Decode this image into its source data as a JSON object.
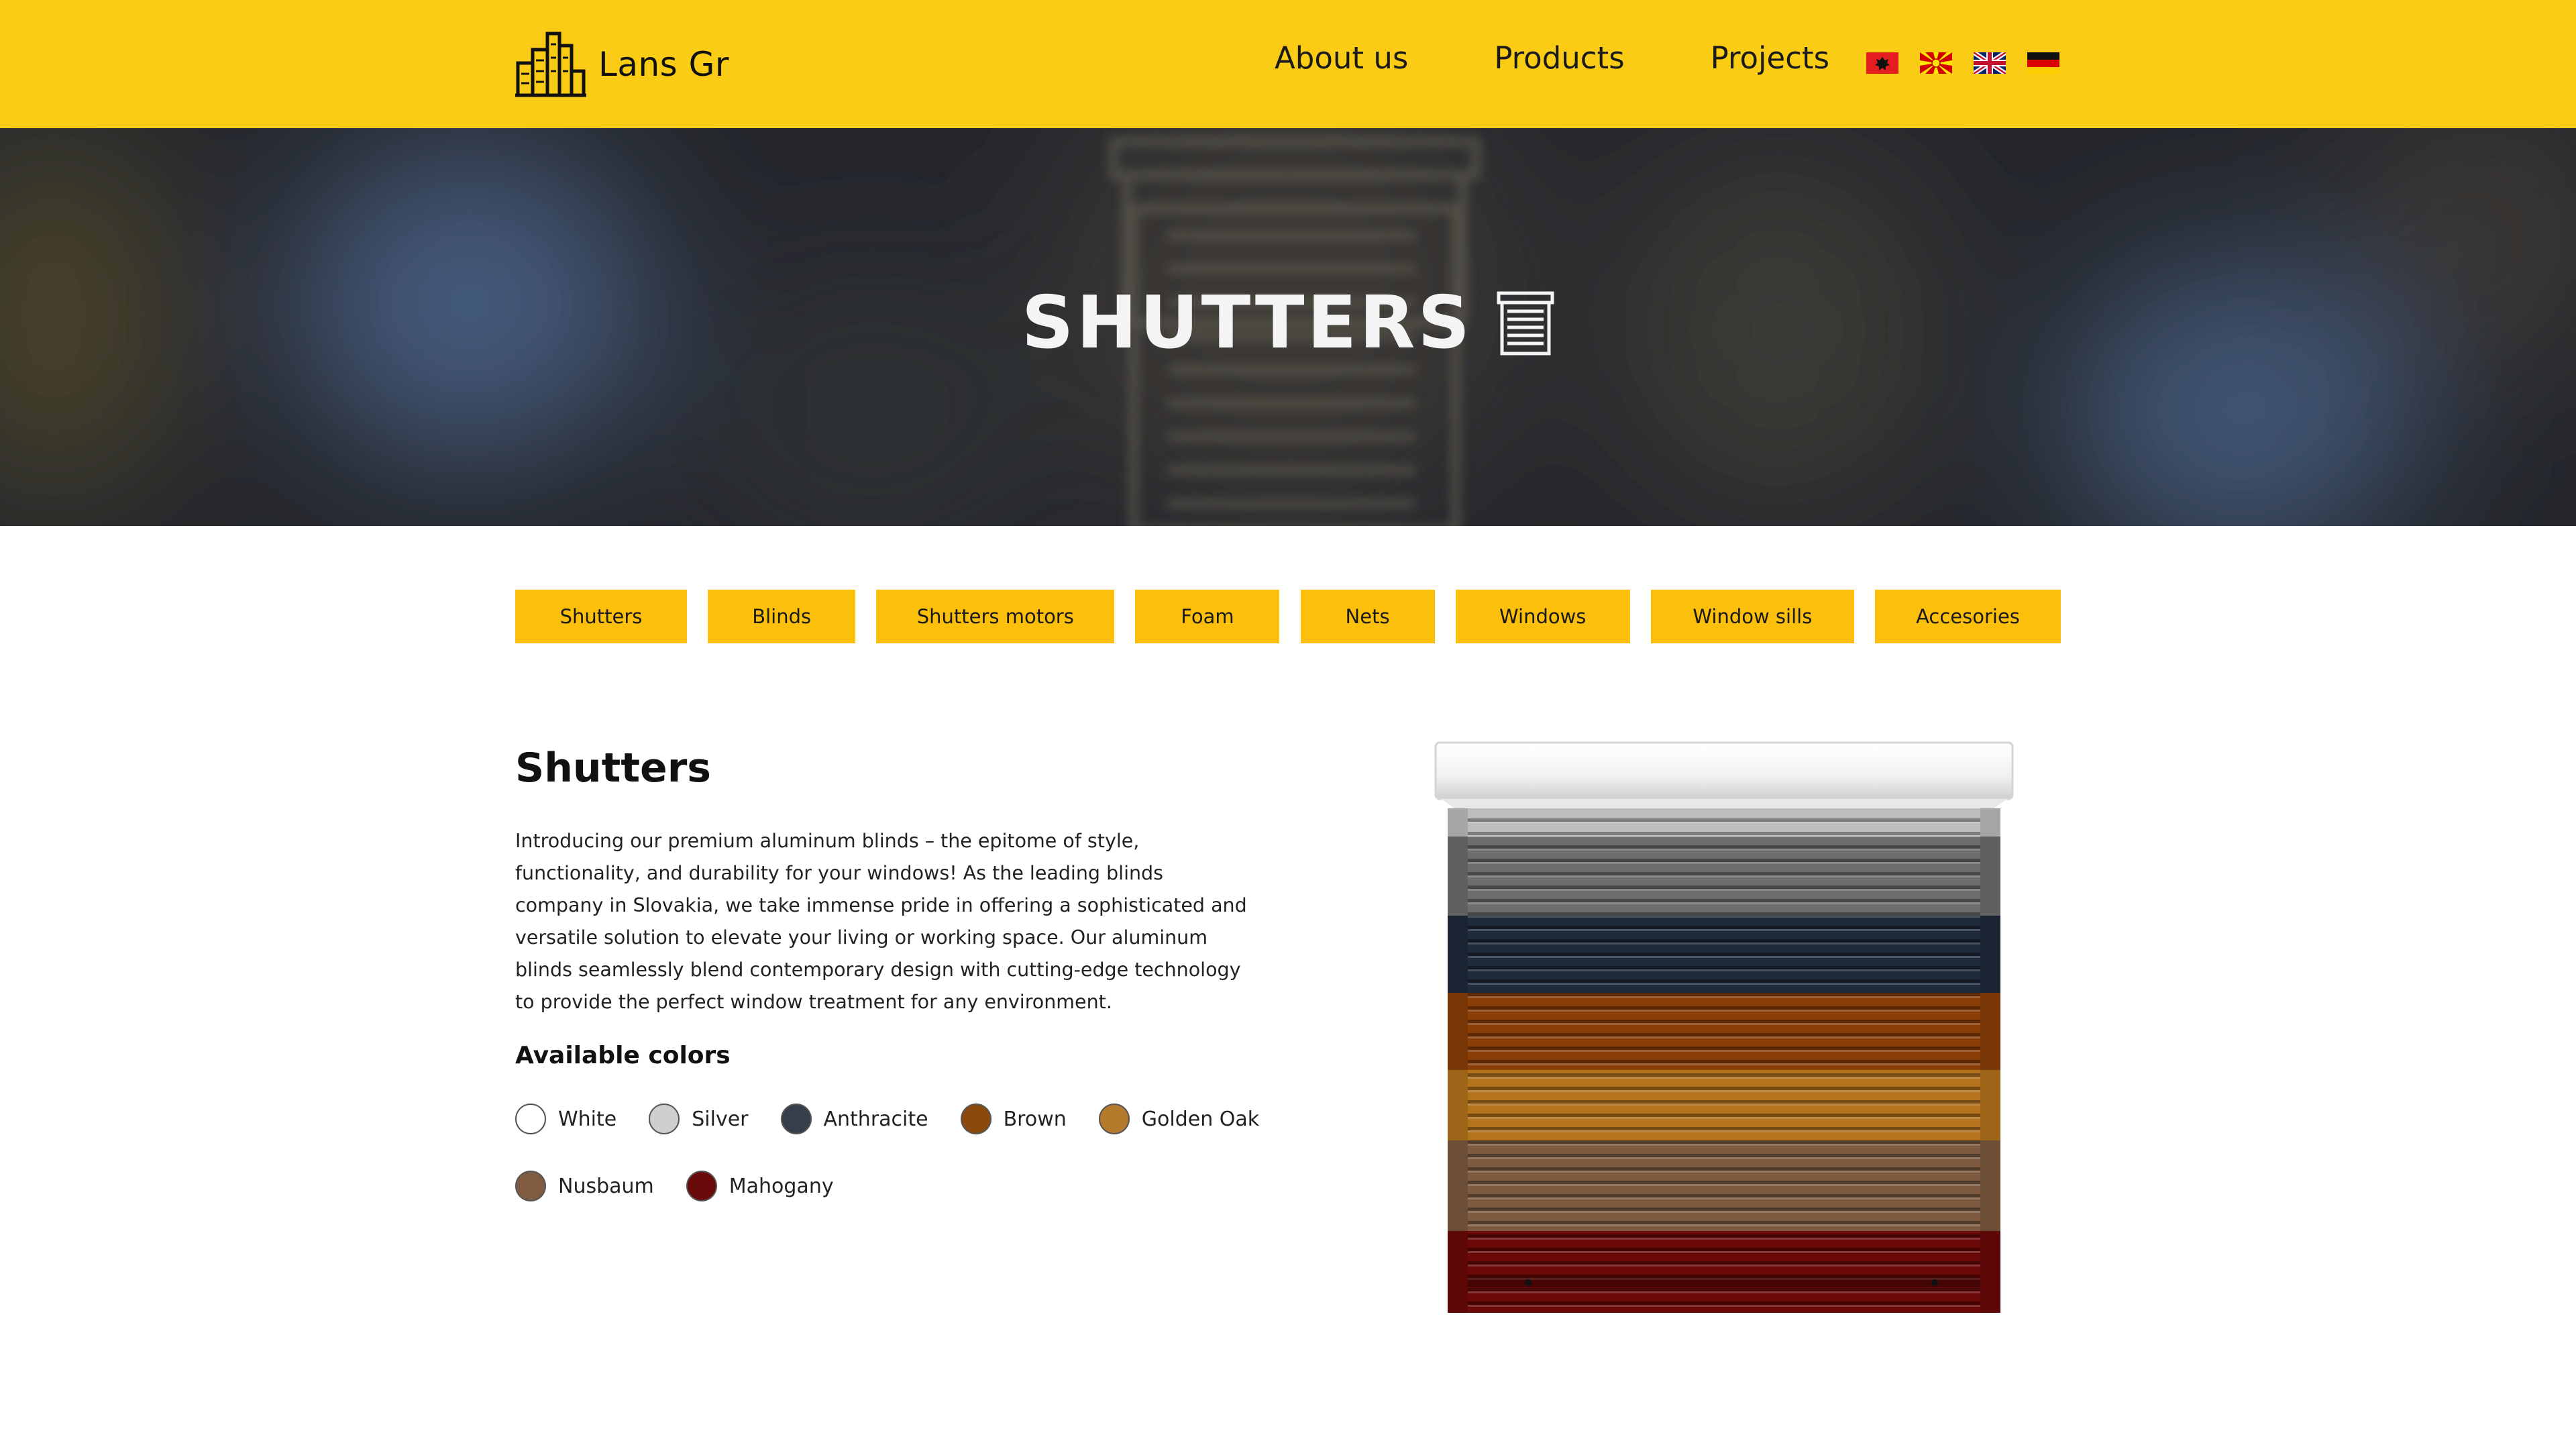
{
  "header": {
    "logo_icon": "buildings-icon",
    "logo_text": "Lans Gr",
    "nav": [
      {
        "label": "About us"
      },
      {
        "label": "Products"
      },
      {
        "label": "Projects"
      }
    ],
    "languages": [
      {
        "icon": "albania-flag-icon"
      },
      {
        "icon": "north-macedonia-flag-icon"
      },
      {
        "icon": "uk-flag-icon"
      },
      {
        "icon": "germany-flag-icon"
      }
    ],
    "background_color": "#facc15"
  },
  "hero": {
    "title": "SHUTTERS",
    "title_icon": "shutter-icon"
  },
  "categories": [
    {
      "label": "Shutters"
    },
    {
      "label": "Blinds"
    },
    {
      "label": "Shutters motors"
    },
    {
      "label": "Foam"
    },
    {
      "label": "Nets"
    },
    {
      "label": "Windows"
    },
    {
      "label": "Window sills"
    },
    {
      "label": "Accesories"
    }
  ],
  "product": {
    "title": "Shutters",
    "description": "Introducing our premium aluminum blinds – the epitome of style, functionality, and durability for your windows! As the leading blinds company in Slovakia, we take immense pride in offering a sophisticated and versatile solution to elevate your living or working space. Our aluminum blinds seamlessly blend contemporary design with cutting-edge technology to provide the perfect window treatment for any environment.",
    "colors_heading": "Available colors",
    "colors": [
      {
        "name": "White",
        "hex": "#ffffff"
      },
      {
        "name": "Silver",
        "hex": "#cfcfcf"
      },
      {
        "name": "Anthracite",
        "hex": "#373e4b"
      },
      {
        "name": "Brown",
        "hex": "#8b4a0c"
      },
      {
        "name": "Golden Oak",
        "hex": "#b57a2c"
      },
      {
        "name": "Nusbaum",
        "hex": "#7f5b42"
      },
      {
        "name": "Mahogany",
        "hex": "#6a0a0a"
      }
    ],
    "image_icon": "shutter-product-image"
  }
}
